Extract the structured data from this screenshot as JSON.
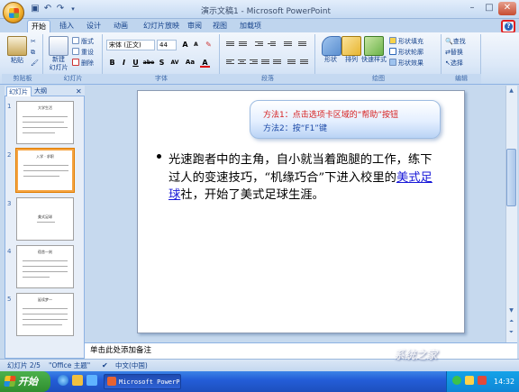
{
  "window": {
    "title": "演示文稿1 - Microsoft PowerPoint",
    "controls": [
      "minimize-icon",
      "maximize-icon",
      "close-icon"
    ]
  },
  "quick_access": [
    "save-icon",
    "undo-icon",
    "redo-icon",
    "customize-icon"
  ],
  "tabs": [
    {
      "label": "开始",
      "active": true
    },
    {
      "label": "插入",
      "active": false
    },
    {
      "label": "设计",
      "active": false
    },
    {
      "label": "动画",
      "active": false
    },
    {
      "label": "幻灯片放映",
      "active": false
    },
    {
      "label": "审阅",
      "active": false
    },
    {
      "label": "视图",
      "active": false
    },
    {
      "label": "加载项",
      "active": false
    }
  ],
  "ribbon": {
    "clipboard": {
      "label": "剪贴板",
      "paste": "粘贴",
      "cut": "剪切",
      "copy": "复制",
      "format_painter": "格式刷"
    },
    "slides": {
      "label": "幻灯片",
      "new_slide": "新建",
      "new_slide2": "幻灯片",
      "layout": "版式",
      "reset": "重设",
      "delete": "删除"
    },
    "font": {
      "label": "字体",
      "font_name": "宋体 (正文)",
      "font_size": "44",
      "grow": "A",
      "shrink": "A",
      "bold": "B",
      "italic": "I",
      "underline": "U",
      "strike": "abe",
      "shadow": "S",
      "spacing": "AV",
      "case": "Aa",
      "color": "A"
    },
    "paragraph": {
      "label": "段落"
    },
    "drawing": {
      "label": "绘图",
      "shapes": "形状",
      "arrange": "排列",
      "quick_styles": "快速样式",
      "fill": "形状填充",
      "outline": "形状轮廓",
      "effects": "形状效果"
    },
    "editing": {
      "label": "编辑",
      "find": "查找",
      "replace": "替换",
      "select": "选择"
    }
  },
  "panel": {
    "tab_slides": "幻灯片",
    "tab_outline": "大纲",
    "thumbs": [
      {
        "num": "1",
        "title": "大学生活"
      },
      {
        "num": "2",
        "title": "入学 · 求职"
      },
      {
        "num": "3",
        "title": "美式足球"
      },
      {
        "num": "4",
        "title": "宿舍一刻"
      },
      {
        "num": "5",
        "title": "延续梦一"
      }
    ]
  },
  "slide": {
    "callout_line1_prefix": "方法1：",
    "callout_line1_text": "点击选项卡区域的“帮助”按钮",
    "callout_line2": "方法2：按“F1”键",
    "body_before": "光速跑者中的主角，自小就当着跑腿的工作，练下过人的变速技巧，“机缘巧合”下进入校里的",
    "body_link": "美式足球",
    "body_after": "社，开始了美式足球生涯。"
  },
  "notes_placeholder": "单击此处添加备注",
  "status": {
    "slide_count": "幻灯片 2/5",
    "theme": "\"Office 主题\"",
    "language": "中文(中国)"
  },
  "taskbar": {
    "start": "开始",
    "app": "Microsoft PowerP...",
    "time": "14:32"
  },
  "watermark": "系统之家"
}
